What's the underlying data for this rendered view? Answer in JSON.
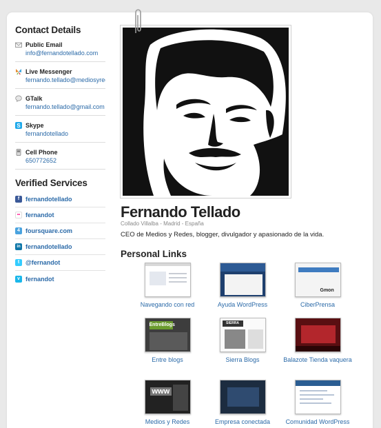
{
  "contact": {
    "heading": "Contact Details",
    "items": [
      {
        "label": "Public Email",
        "value": "info@fernandotellado.com",
        "icon": "envelope-icon"
      },
      {
        "label": "Live Messenger",
        "value": "fernando.tellado@mediosyredes",
        "icon": "butterfly-icon"
      },
      {
        "label": "GTalk",
        "value": "fernando.tellado@gmail.com",
        "icon": "speech-icon"
      },
      {
        "label": "Skype",
        "value": "fernandotellado",
        "icon": "skype-icon"
      },
      {
        "label": "Cell Phone",
        "value": "650772652",
        "icon": "phone-icon"
      }
    ]
  },
  "verified": {
    "heading": "Verified Services",
    "items": [
      {
        "label": "fernandotellado",
        "icon": "facebook-icon",
        "color": "#3b5998",
        "glyph": "f"
      },
      {
        "label": "fernandot",
        "icon": "flickr-icon",
        "color": "#ff0084",
        "glyph": "••"
      },
      {
        "label": "foursquare.com",
        "icon": "foursquare-icon",
        "color": "#4aa3df",
        "glyph": "4"
      },
      {
        "label": "fernandotellado",
        "icon": "linkedin-icon",
        "color": "#0e76a8",
        "glyph": "in"
      },
      {
        "label": "@fernandot",
        "icon": "twitter-icon",
        "color": "#33ccff",
        "glyph": "t"
      },
      {
        "label": "fernandot",
        "icon": "vimeo-icon",
        "color": "#1ab7ea",
        "glyph": "v"
      }
    ]
  },
  "profile": {
    "name": "Fernando Tellado",
    "location": "Collado Villalba - Madrid - España",
    "bio": "CEO de Medios y Redes, blogger, divulgador y apasionado de la vida."
  },
  "links": {
    "heading": "Personal Links",
    "items": [
      {
        "label": "Navegando con red"
      },
      {
        "label": "Ayuda WordPress"
      },
      {
        "label": "CiberPrensa",
        "thumb_text": "Gmon"
      },
      {
        "label": "Entre blogs",
        "thumb_text": "EntreBlogs"
      },
      {
        "label": "Sierra Blogs",
        "thumb_text": "SIERRA BLOGS"
      },
      {
        "label": "Balazote Tienda vaquera"
      },
      {
        "label": "Medios y Redes",
        "thumb_text": "www"
      },
      {
        "label": "Empresa conectada"
      },
      {
        "label": "Comunidad WordPress"
      }
    ]
  },
  "colors": {
    "link": "#2b6aa8",
    "heading": "#222222",
    "muted": "#888888"
  }
}
